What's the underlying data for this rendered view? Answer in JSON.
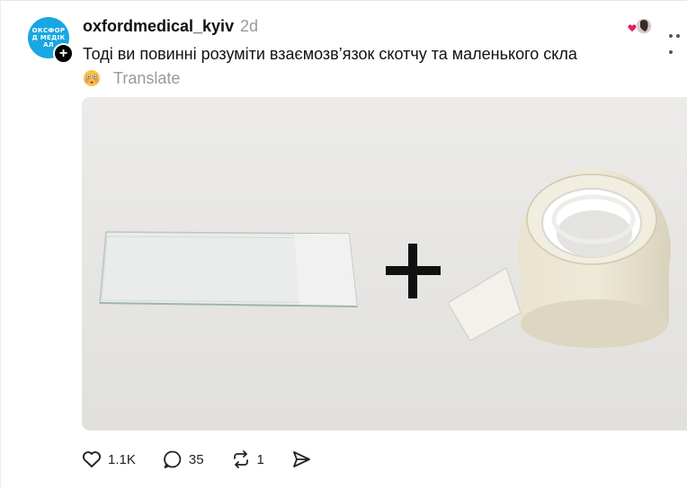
{
  "post": {
    "username": "oxfordmedical_kyiv",
    "timestamp": "2d",
    "avatar_text": "ОКСФОРД МЕДІКАЛ",
    "text": "Тоді ви повинні розуміти взаємозв’язок скотчу та маленького скла",
    "translate_label": "Translate"
  },
  "icons": {
    "follow": "plus-icon",
    "liked_by": "heart-avatar-icon",
    "more": "more-dots-icon",
    "translate": "flushed-face-emoji-icon",
    "like": "heart-outline-icon",
    "reply": "comment-bubble-icon",
    "repost": "repost-arrows-icon",
    "share": "send-icon"
  },
  "actions": {
    "likes": "1.1K",
    "replies": "35",
    "reposts": "1"
  },
  "colors": {
    "avatar_bg": "#18a7e3",
    "like_heart": "#e0245e",
    "muted_text": "#999999"
  }
}
